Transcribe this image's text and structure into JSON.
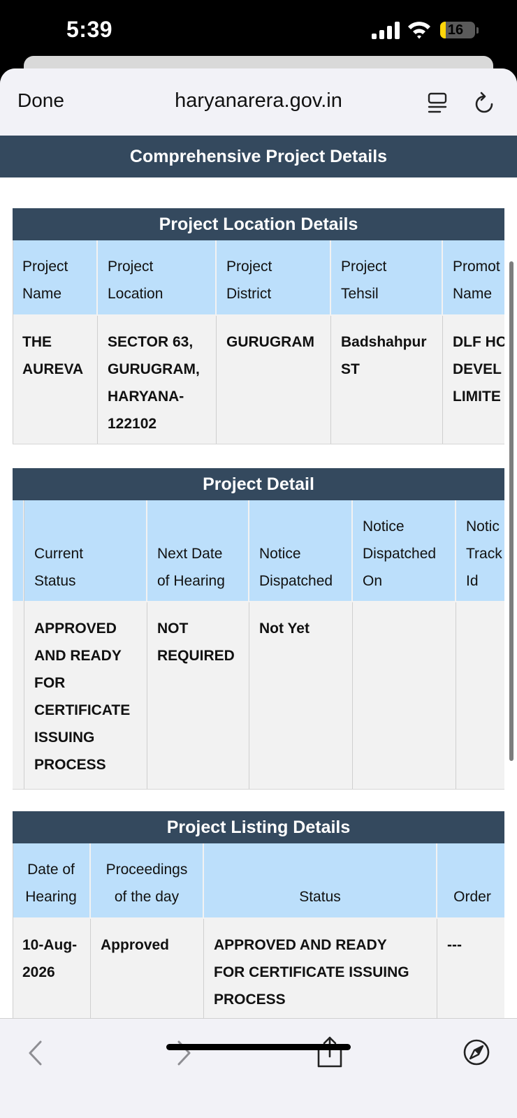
{
  "status_bar": {
    "time": "5:39",
    "battery": "16",
    "battery_level": 0.16
  },
  "browser": {
    "done_label": "Done",
    "domain": "haryanarera.gov.in"
  },
  "page": {
    "header": "Comprehensive Project Details"
  },
  "location_table": {
    "title": "Project Location Details",
    "headers": [
      "Project\nName",
      "Project\nLocation",
      "Project\nDistrict",
      "Project\nTehsil",
      "Promot\nName"
    ],
    "row": [
      "THE\nAUREVA",
      "SECTOR 63,\nGURUGRAM,\nHARYANA-\n122102",
      "GURUGRAM",
      "Badshahpur\nST",
      "DLF HC\nDEVEL\nLIMITE"
    ]
  },
  "detail_table": {
    "title": "Project Detail",
    "headers": [
      "",
      "Current\nStatus",
      "Next Date\nof Hearing",
      "Notice\nDispatched",
      "Notice\nDispatched\nOn",
      "Notic\nTrack\nId"
    ],
    "row": [
      "",
      "APPROVED\nAND READY\nFOR\nCERTIFICATE\nISSUING\nPROCESS",
      "NOT\nREQUIRED",
      "Not Yet",
      "",
      ""
    ]
  },
  "listing_table": {
    "title": "Project Listing Details",
    "headers": [
      "Date of\nHearing",
      "Proceedings\nof the day",
      "Status",
      "Order"
    ],
    "row": [
      "10-Aug-\n2026",
      "Approved",
      "APPROVED AND READY\nFOR CERTIFICATE ISSUING\nPROCESS",
      "---"
    ]
  }
}
